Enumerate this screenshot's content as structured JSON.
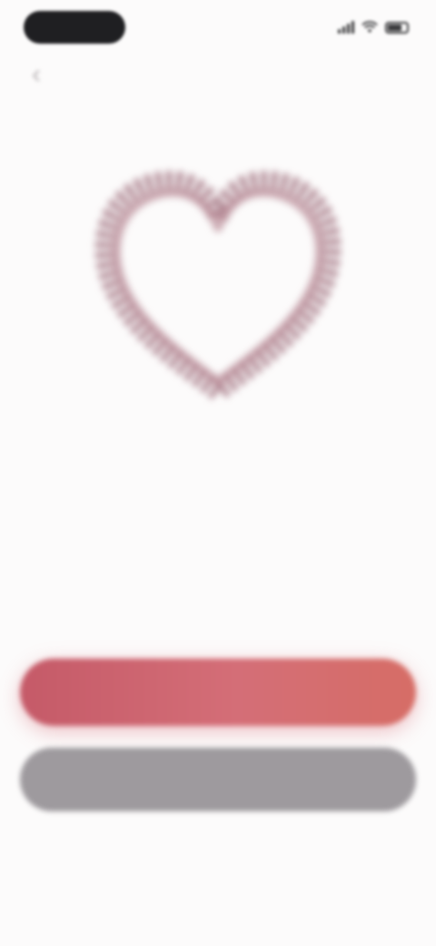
{
  "status_bar": {
    "time": "",
    "signal_icon": "signal-icon",
    "wifi_icon": "wifi-icon",
    "battery_icon": "battery-icon"
  },
  "header": {
    "back_icon": "chevron-left-icon",
    "title": ""
  },
  "illustration": {
    "icon": "heart-icon",
    "color": "#9e6c7a"
  },
  "content": {
    "headline": "",
    "subtext_line_1": "",
    "subtext_line_2": ""
  },
  "actions": {
    "primary_label": "",
    "primary_color": "#cd6370",
    "secondary_label": "",
    "secondary_color": "#9e9a9e"
  }
}
